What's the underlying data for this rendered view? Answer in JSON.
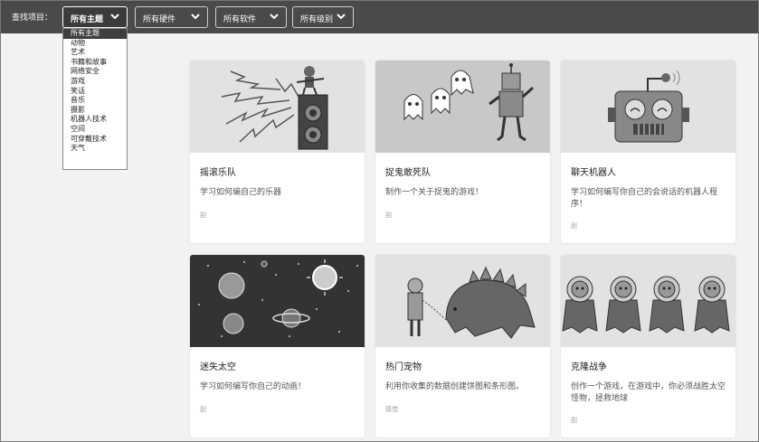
{
  "filters": {
    "label": "查找项目：",
    "topic": "所有主题",
    "hardware": "所有硬件",
    "software": "所有软件",
    "level": "所有级别"
  },
  "topic_options": [
    "所有主题",
    "动物",
    "艺术",
    "书籍和故事",
    "网络安全",
    "游戏",
    "笑话",
    "音乐",
    "摄影",
    "机器人技术",
    "空间",
    "可穿戴技术",
    "天气"
  ],
  "cards": [
    {
      "title": "摇滚乐队",
      "desc": "学习如何编自己的乐器",
      "tag": "刮",
      "thumb": "rock-band-illustration"
    },
    {
      "title": "捉鬼敢死队",
      "desc": "制作一个关于捉鬼的游戏！",
      "tag": "刮",
      "thumb": "ghostbusters-illustration"
    },
    {
      "title": "聊天机器人",
      "desc": "学习如何编写你自己的会说话的机器人程序！",
      "tag": "刮",
      "thumb": "chatbot-illustration"
    },
    {
      "title": "迷失太空",
      "desc": "学习如何编写你自己的动画！",
      "tag": "刮",
      "thumb": "space-illustration"
    },
    {
      "title": "热门宠物",
      "desc": "利用你收集的数据创建饼图和条形图。",
      "tag": "感觉",
      "thumb": "pet-dinosaur-illustration"
    },
    {
      "title": "克隆战争",
      "desc": "创作一个游戏，在游戏中，你必须战胜太空怪物，拯救地球",
      "tag": "刮",
      "thumb": "clone-wars-illustration"
    }
  ]
}
